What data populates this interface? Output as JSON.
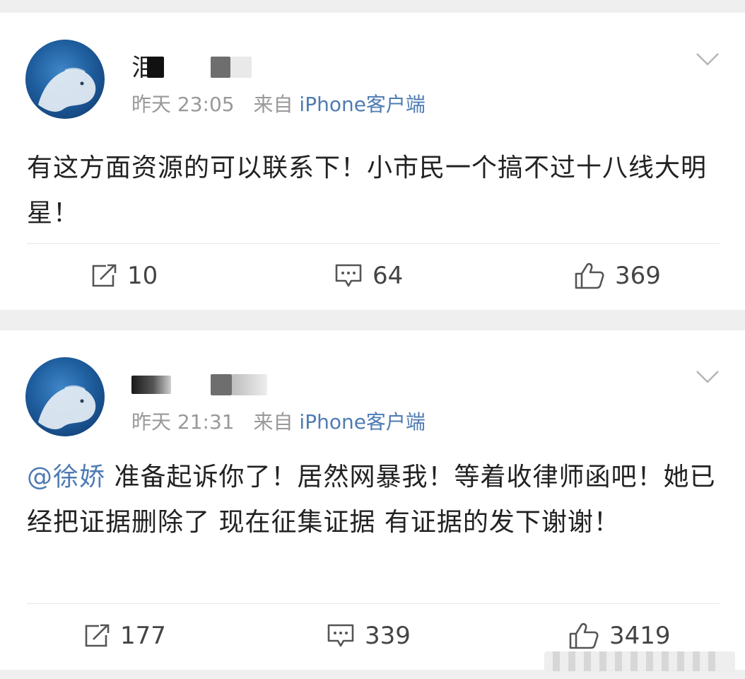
{
  "posts": [
    {
      "author_visible_char": "泪",
      "time": "昨天 23:05",
      "from_label": "来自",
      "source": "iPhone客户端",
      "content": "有这方面资源的可以联系下！小市民一个搞不过十八线大明星！",
      "reposts": "10",
      "comments": "64",
      "likes": "369"
    },
    {
      "author_visible_char": "",
      "time": "昨天 21:31",
      "from_label": "来自",
      "source": "iPhone客户端",
      "mention": "@徐娇",
      "content": " 准备起诉你了！居然网暴我！等着收律师函吧！她已经把证据删除了 现在征集证据 有证据的发下谢谢！",
      "reposts": "177",
      "comments": "339",
      "likes": "3419"
    }
  ],
  "colors": {
    "page_bg": "#efefef",
    "card_bg": "#ffffff",
    "text": "#222222",
    "meta": "#999999",
    "link": "#4e7bb3"
  },
  "icons": [
    "chevron-down-icon",
    "repost-icon",
    "comment-icon",
    "like-icon"
  ]
}
